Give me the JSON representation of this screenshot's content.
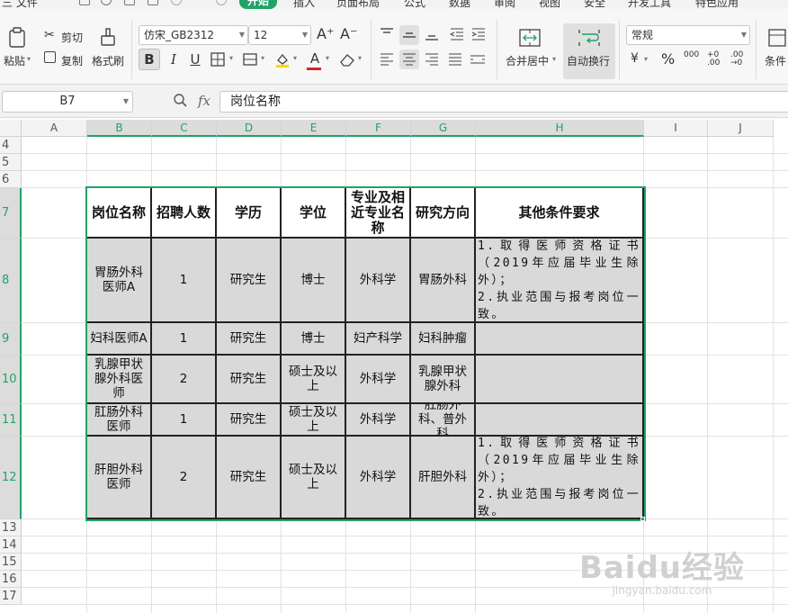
{
  "menu": {
    "file": "三 文件",
    "tabs": [
      "开始",
      "插入",
      "页面布局",
      "公式",
      "数据",
      "审阅",
      "视图",
      "安全",
      "开发工具",
      "特色应用"
    ]
  },
  "ribbon": {
    "paste": "粘贴",
    "cut": "剪切",
    "copy": "复制",
    "format_painter": "格式刷",
    "font_name": "仿宋_GB2312",
    "font_size": "12",
    "merge_center": "合并居中",
    "wrap_text": "自动换行",
    "number_format": "常规",
    "conditions": "条件",
    "percent": "%",
    "thousands": "000",
    "inc_decimal": "+0 .00",
    "dec_decimal": ".00 →0",
    "bold": "B",
    "italic": "I",
    "underline": "U",
    "font_color": "A",
    "grow_font": "A⁺",
    "shrink_font": "A⁻"
  },
  "formula_bar": {
    "name_box": "B7",
    "fx": "fx",
    "content": "岗位名称"
  },
  "sheet": {
    "columns": [
      "A",
      "B",
      "C",
      "D",
      "E",
      "F",
      "G",
      "H",
      "I",
      "J"
    ],
    "rows": [
      "4",
      "5",
      "6",
      "7",
      "8",
      "9",
      "10",
      "11",
      "12",
      "13",
      "14",
      "15",
      "16",
      "17"
    ],
    "table": {
      "headers": [
        "岗位名称",
        "招聘人数",
        "学历",
        "学位",
        "专业及相近专业名称",
        "研究方向",
        "其他条件要求"
      ],
      "rows": [
        [
          "胃肠外科医师A",
          "1",
          "研究生",
          "博士",
          "外科学",
          "胃肠外科",
          "1.取得医师资格证书（2019年应届毕业生除外）；\n2.执业范围与报考岗位一致。"
        ],
        [
          "妇科医师A",
          "1",
          "研究生",
          "博士",
          "妇产科学",
          "妇科肿瘤",
          ""
        ],
        [
          "乳腺甲状腺外科医师",
          "2",
          "研究生",
          "硕士及以上",
          "外科学",
          "乳腺甲状腺外科",
          ""
        ],
        [
          "肛肠外科医师",
          "1",
          "研究生",
          "硕士及以上",
          "外科学",
          "肛肠外科、普外科",
          ""
        ],
        [
          "肝胆外科医师",
          "2",
          "研究生",
          "硕士及以上",
          "外科学",
          "肝胆外科",
          "1.取得医师资格证书（2019年应届毕业生除外）；\n2.执业范围与报考岗位一致。"
        ]
      ]
    }
  },
  "watermark": {
    "brand": "Baidu经验",
    "url": "jingyan.baidu.com"
  }
}
